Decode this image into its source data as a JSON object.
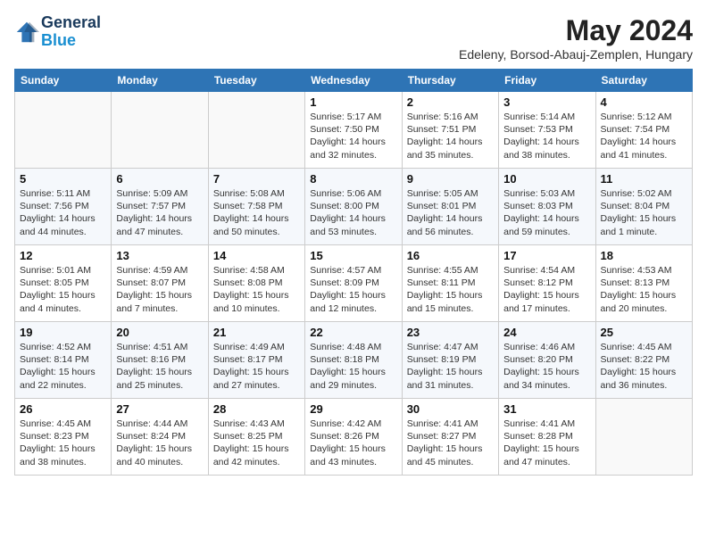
{
  "header": {
    "logo_line1": "General",
    "logo_line2": "Blue",
    "month": "May 2024",
    "location": "Edeleny, Borsod-Abauj-Zemplen, Hungary"
  },
  "weekdays": [
    "Sunday",
    "Monday",
    "Tuesday",
    "Wednesday",
    "Thursday",
    "Friday",
    "Saturday"
  ],
  "weeks": [
    [
      {
        "day": "",
        "info": ""
      },
      {
        "day": "",
        "info": ""
      },
      {
        "day": "",
        "info": ""
      },
      {
        "day": "1",
        "info": "Sunrise: 5:17 AM\nSunset: 7:50 PM\nDaylight: 14 hours\nand 32 minutes."
      },
      {
        "day": "2",
        "info": "Sunrise: 5:16 AM\nSunset: 7:51 PM\nDaylight: 14 hours\nand 35 minutes."
      },
      {
        "day": "3",
        "info": "Sunrise: 5:14 AM\nSunset: 7:53 PM\nDaylight: 14 hours\nand 38 minutes."
      },
      {
        "day": "4",
        "info": "Sunrise: 5:12 AM\nSunset: 7:54 PM\nDaylight: 14 hours\nand 41 minutes."
      }
    ],
    [
      {
        "day": "5",
        "info": "Sunrise: 5:11 AM\nSunset: 7:56 PM\nDaylight: 14 hours\nand 44 minutes."
      },
      {
        "day": "6",
        "info": "Sunrise: 5:09 AM\nSunset: 7:57 PM\nDaylight: 14 hours\nand 47 minutes."
      },
      {
        "day": "7",
        "info": "Sunrise: 5:08 AM\nSunset: 7:58 PM\nDaylight: 14 hours\nand 50 minutes."
      },
      {
        "day": "8",
        "info": "Sunrise: 5:06 AM\nSunset: 8:00 PM\nDaylight: 14 hours\nand 53 minutes."
      },
      {
        "day": "9",
        "info": "Sunrise: 5:05 AM\nSunset: 8:01 PM\nDaylight: 14 hours\nand 56 minutes."
      },
      {
        "day": "10",
        "info": "Sunrise: 5:03 AM\nSunset: 8:03 PM\nDaylight: 14 hours\nand 59 minutes."
      },
      {
        "day": "11",
        "info": "Sunrise: 5:02 AM\nSunset: 8:04 PM\nDaylight: 15 hours\nand 1 minute."
      }
    ],
    [
      {
        "day": "12",
        "info": "Sunrise: 5:01 AM\nSunset: 8:05 PM\nDaylight: 15 hours\nand 4 minutes."
      },
      {
        "day": "13",
        "info": "Sunrise: 4:59 AM\nSunset: 8:07 PM\nDaylight: 15 hours\nand 7 minutes."
      },
      {
        "day": "14",
        "info": "Sunrise: 4:58 AM\nSunset: 8:08 PM\nDaylight: 15 hours\nand 10 minutes."
      },
      {
        "day": "15",
        "info": "Sunrise: 4:57 AM\nSunset: 8:09 PM\nDaylight: 15 hours\nand 12 minutes."
      },
      {
        "day": "16",
        "info": "Sunrise: 4:55 AM\nSunset: 8:11 PM\nDaylight: 15 hours\nand 15 minutes."
      },
      {
        "day": "17",
        "info": "Sunrise: 4:54 AM\nSunset: 8:12 PM\nDaylight: 15 hours\nand 17 minutes."
      },
      {
        "day": "18",
        "info": "Sunrise: 4:53 AM\nSunset: 8:13 PM\nDaylight: 15 hours\nand 20 minutes."
      }
    ],
    [
      {
        "day": "19",
        "info": "Sunrise: 4:52 AM\nSunset: 8:14 PM\nDaylight: 15 hours\nand 22 minutes."
      },
      {
        "day": "20",
        "info": "Sunrise: 4:51 AM\nSunset: 8:16 PM\nDaylight: 15 hours\nand 25 minutes."
      },
      {
        "day": "21",
        "info": "Sunrise: 4:49 AM\nSunset: 8:17 PM\nDaylight: 15 hours\nand 27 minutes."
      },
      {
        "day": "22",
        "info": "Sunrise: 4:48 AM\nSunset: 8:18 PM\nDaylight: 15 hours\nand 29 minutes."
      },
      {
        "day": "23",
        "info": "Sunrise: 4:47 AM\nSunset: 8:19 PM\nDaylight: 15 hours\nand 31 minutes."
      },
      {
        "day": "24",
        "info": "Sunrise: 4:46 AM\nSunset: 8:20 PM\nDaylight: 15 hours\nand 34 minutes."
      },
      {
        "day": "25",
        "info": "Sunrise: 4:45 AM\nSunset: 8:22 PM\nDaylight: 15 hours\nand 36 minutes."
      }
    ],
    [
      {
        "day": "26",
        "info": "Sunrise: 4:45 AM\nSunset: 8:23 PM\nDaylight: 15 hours\nand 38 minutes."
      },
      {
        "day": "27",
        "info": "Sunrise: 4:44 AM\nSunset: 8:24 PM\nDaylight: 15 hours\nand 40 minutes."
      },
      {
        "day": "28",
        "info": "Sunrise: 4:43 AM\nSunset: 8:25 PM\nDaylight: 15 hours\nand 42 minutes."
      },
      {
        "day": "29",
        "info": "Sunrise: 4:42 AM\nSunset: 8:26 PM\nDaylight: 15 hours\nand 43 minutes."
      },
      {
        "day": "30",
        "info": "Sunrise: 4:41 AM\nSunset: 8:27 PM\nDaylight: 15 hours\nand 45 minutes."
      },
      {
        "day": "31",
        "info": "Sunrise: 4:41 AM\nSunset: 8:28 PM\nDaylight: 15 hours\nand 47 minutes."
      },
      {
        "day": "",
        "info": ""
      }
    ]
  ]
}
